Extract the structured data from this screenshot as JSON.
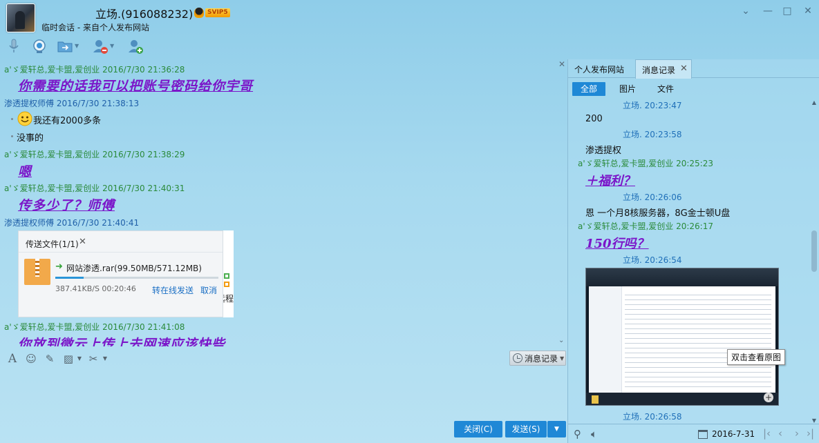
{
  "header": {
    "title": "立场.(916088232)",
    "vip": "SVIP5",
    "subtitle": "临时会话 - 来自个人发布网站",
    "window_controls": [
      "chevron-down-icon",
      "minimize-icon",
      "maximize-icon",
      "close-icon"
    ]
  },
  "toolbar": {
    "items": [
      "microphone-icon",
      "video-camera-icon",
      "folder-transfer-icon",
      "remove-contact-icon",
      "add-contact-icon"
    ]
  },
  "chat": {
    "messages": [
      {
        "sender": "a'ゞ爱轩总,爱卡盟,爱创业",
        "time": "2016/7/30 21:36:28",
        "text": "你需要的话我可以把账号密码给你宇哥"
      },
      {
        "sender": "渗透提权师傅",
        "time": "2016/7/30 21:38:13",
        "lines": [
          "我还有2000多条",
          "没事的"
        ]
      },
      {
        "sender": "a'ゞ爱轩总,爱卡盟,爱创业",
        "time": "2016/7/30 21:38:29",
        "text": "嗯"
      },
      {
        "sender": "a'ゞ爱轩总,爱卡盟,爱创业",
        "time": "2016/7/30 21:40:31",
        "text": "传多少了？师傅"
      },
      {
        "sender": "渗透提权师傅",
        "time": "2016/7/30 21:40:41"
      },
      {
        "sender": "a'ゞ爱轩总,爱卡盟,爱创业",
        "time": "2016/7/30 21:41:08",
        "text": "你放到微云上传上去网速应该快些"
      }
    ],
    "edge_text": "远程"
  },
  "transfer": {
    "title": "传送文件(1/1)",
    "file_name": "网站渗透.rar(99.50MB/571.12MB)",
    "speed": "387.41KB/S 00:20:46",
    "offline_label": "转在线发送",
    "cancel_label": "取消",
    "progress": 0.174
  },
  "compose": {
    "tools": [
      "font-icon",
      "emoji-icon",
      "edit-icon",
      "image-icon",
      "scissors-icon"
    ],
    "history_label": "消息记录",
    "close_label": "关闭(C)",
    "send_label": "发送(S)"
  },
  "right_panel": {
    "tabs": {
      "site": "个人发布网站",
      "history": "消息记录"
    },
    "filters": {
      "all": "全部",
      "images": "图片",
      "files": "文件"
    },
    "messages": {
      "m1_time": "立场. 20:23:47",
      "m1_text": "200",
      "m2_time": "立场. 20:23:58",
      "m2_text": "渗透提权",
      "m3_meta": "a'ゞ爱轩总,爱卡盟,爱创业  20:25:23",
      "m3_text": "＋福利？",
      "m4_time": "立场. 20:26:06",
      "m4_text": "恩  一个月8核服务器，8G金士顿U盘",
      "m5_meta": "a'ゞ爱轩总,爱卡盟,爱创业  20:26:17",
      "m5_text": "150行吗？",
      "m6_time": "立场. 20:26:54",
      "m7_time": "立场. 20:26:58"
    },
    "thumbnail_tooltip": "双击查看原图",
    "date": "2016-7-31"
  },
  "colors": {
    "accent": "#1f88d6",
    "fancy_text": "#7b16c9",
    "sender_green": "#2a8a3a",
    "sender_blue": "#1f5fa8"
  }
}
